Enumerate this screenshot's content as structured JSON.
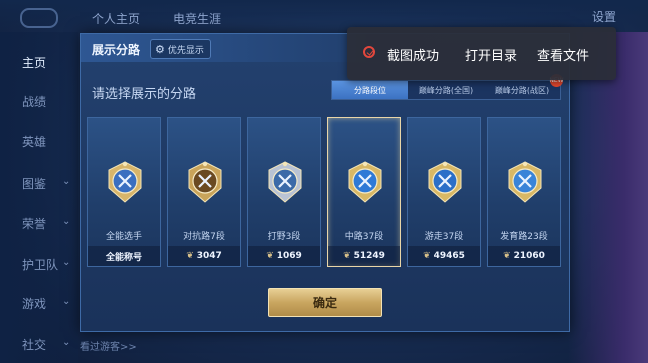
{
  "background": {
    "tabs": [
      "个人主页",
      "电竞生涯"
    ],
    "settings_label": "设置",
    "sidebar": [
      {
        "label": "主页",
        "active": true,
        "arrow": false
      },
      {
        "label": "战绩",
        "active": false,
        "arrow": false
      },
      {
        "label": "英雄",
        "active": false,
        "arrow": false
      },
      {
        "label": "图鉴",
        "active": false,
        "arrow": true
      },
      {
        "label": "荣誉",
        "active": false,
        "arrow": true
      },
      {
        "label": "护卫队",
        "active": false,
        "arrow": true
      },
      {
        "label": "游戏",
        "active": false,
        "arrow": true
      },
      {
        "label": "社交",
        "active": false,
        "arrow": true
      }
    ],
    "bottom_text": "看过游客>>"
  },
  "dialog": {
    "title": "展示分路",
    "priority_button": "优先显示",
    "prompt": "请选择展示的分路",
    "tabs": [
      {
        "label": "分路段位",
        "active": true
      },
      {
        "label": "巅峰分路(全国)",
        "active": false
      },
      {
        "label": "巅峰分路(战区)",
        "active": false,
        "badge": "NEW"
      }
    ],
    "cards": [
      {
        "label": "全能选手",
        "value": "全能称号",
        "show_chevron": false,
        "selected": false,
        "emblem": "all-round-emblem",
        "metal": "#d8b56a",
        "inner": "#3a6fc0"
      },
      {
        "label": "对抗路7段",
        "value": "3047",
        "show_chevron": true,
        "selected": false,
        "emblem": "clash-lane-emblem",
        "metal": "#c9a45a",
        "inner": "#6a4a22"
      },
      {
        "label": "打野3段",
        "value": "1069",
        "show_chevron": true,
        "selected": false,
        "emblem": "jungle-emblem",
        "metal": "#b9c3d4",
        "inner": "#3b6aa8"
      },
      {
        "label": "中路37段",
        "value": "51249",
        "show_chevron": true,
        "selected": true,
        "emblem": "mid-lane-emblem",
        "metal": "#d9b865",
        "inner": "#2f7ad6"
      },
      {
        "label": "游走37段",
        "value": "49465",
        "show_chevron": true,
        "selected": false,
        "emblem": "roam-emblem",
        "metal": "#d9b865",
        "inner": "#2b6fc8"
      },
      {
        "label": "发育路23段",
        "value": "21060",
        "show_chevron": true,
        "selected": false,
        "emblem": "farm-lane-emblem",
        "metal": "#d9b865",
        "inner": "#3a84d8"
      }
    ],
    "confirm_button": "确定"
  },
  "toast": {
    "message": "截图成功",
    "open_dir": "打开目录",
    "view_file": "查看文件",
    "icon_color": "#e2473d"
  }
}
